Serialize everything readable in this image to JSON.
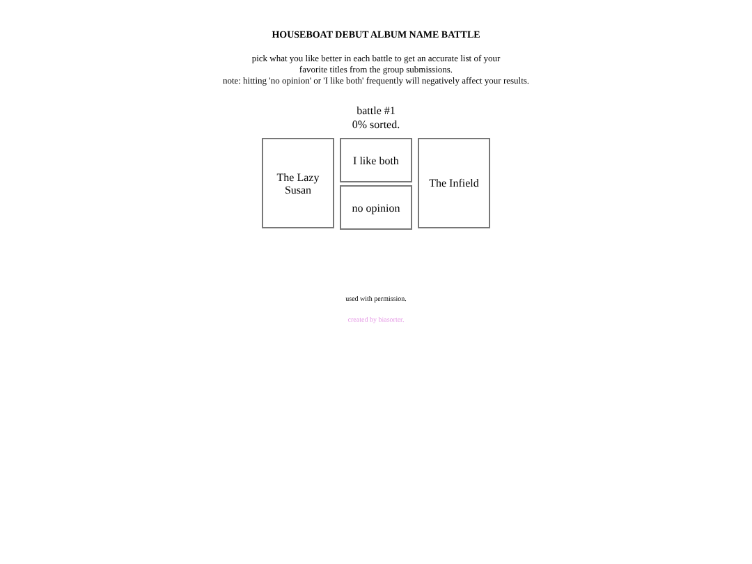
{
  "title": "HOUSEBOAT DEBUT ALBUM NAME BATTLE",
  "description": [
    "pick what you like better in each battle to get an accurate list of your",
    "favorite titles from the group submissions.",
    "note: hitting 'no opinion' or 'I like both' frequently will negatively affect your results."
  ],
  "battle": {
    "number": "battle #1",
    "progress": "0% sorted."
  },
  "left_option": "The Lazy Susan",
  "tie_option": "I like both",
  "skip_option": "no opinion",
  "right_option": "The Infield",
  "footer": {
    "note": "used with permission.",
    "credit": "created by biasorter."
  }
}
